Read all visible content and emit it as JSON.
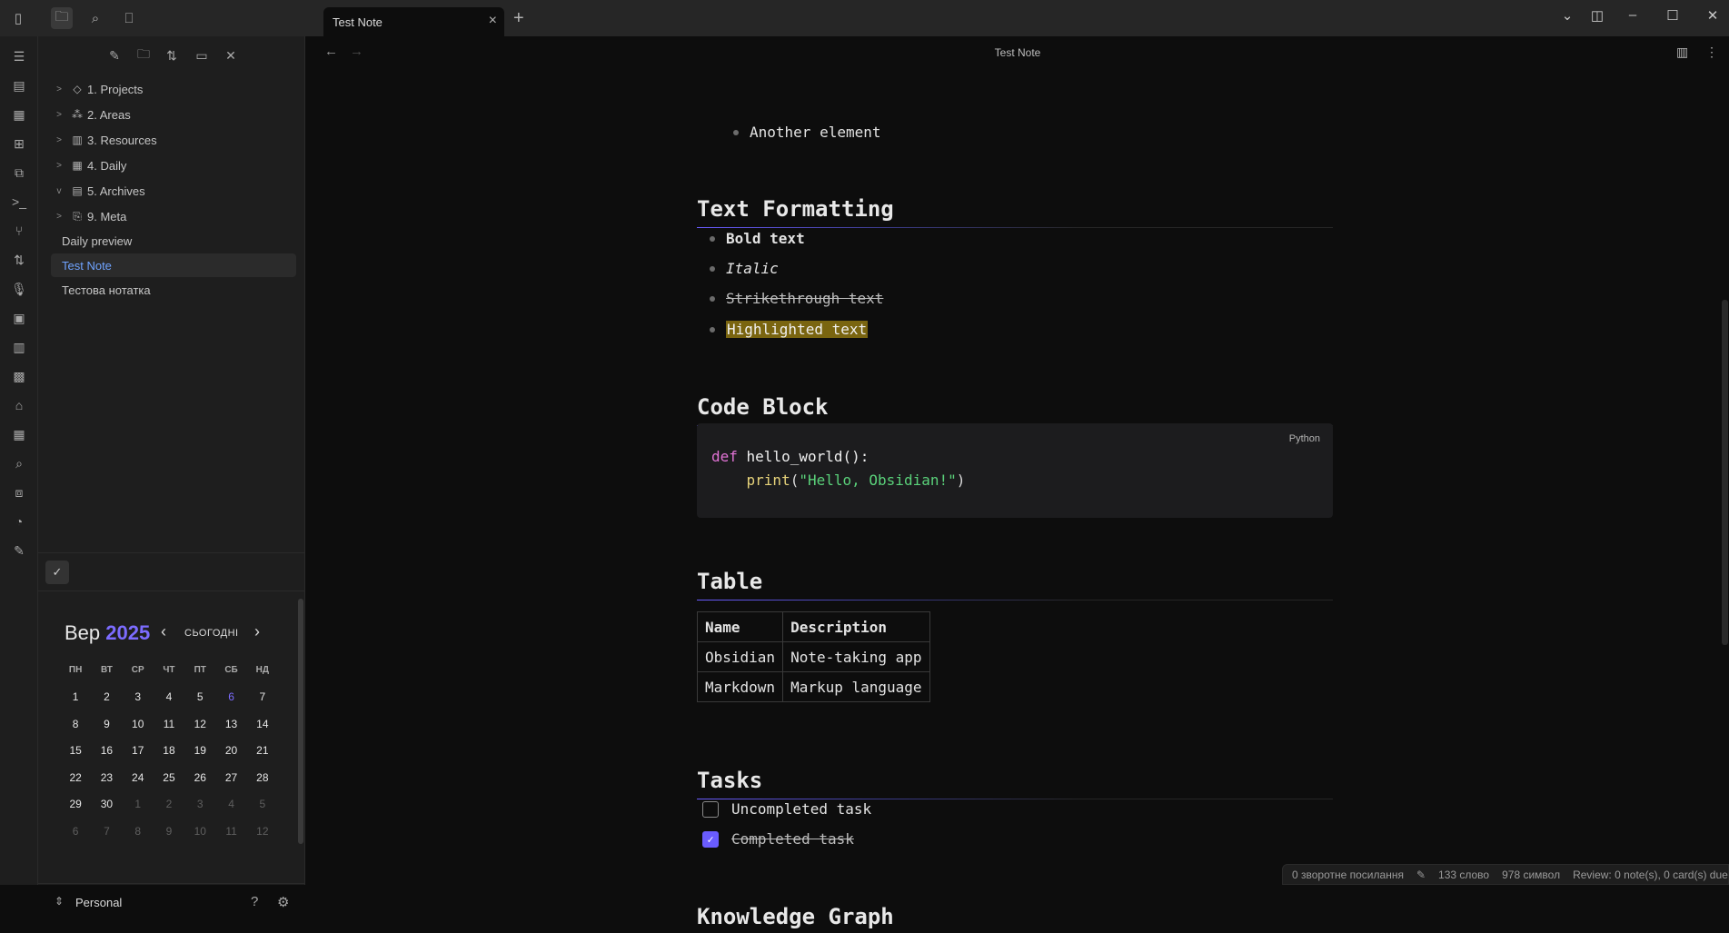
{
  "titlebar": {
    "tab_title": "Test Note",
    "tab_close_icon": "×",
    "new_tab_icon": "+"
  },
  "explorer": {
    "folders": [
      {
        "label": "1. Projects",
        "icon": "tag-icon",
        "expanded": false
      },
      {
        "label": "2. Areas",
        "icon": "areas-icon",
        "expanded": false
      },
      {
        "label": "3. Resources",
        "icon": "book-icon",
        "expanded": false
      },
      {
        "label": "4. Daily",
        "icon": "calendar-icon",
        "expanded": false
      },
      {
        "label": "5. Archives",
        "icon": "archive-icon",
        "expanded": true
      },
      {
        "label": "9. Meta",
        "icon": "meta-icon",
        "expanded": false
      }
    ],
    "files": [
      {
        "label": "Daily preview",
        "active": false
      },
      {
        "label": "Test Note",
        "active": true
      },
      {
        "label": "Тестова нотатка",
        "active": false
      }
    ]
  },
  "calendar": {
    "month": "Вер",
    "year": "2025",
    "today_label": "СЬОГОДНІ",
    "weekdays": [
      "ПН",
      "ВТ",
      "СР",
      "ЧТ",
      "ПТ",
      "СБ",
      "НД"
    ],
    "weeks": [
      [
        "1",
        "2",
        "3",
        "4",
        "5",
        "6",
        "7"
      ],
      [
        "8",
        "9",
        "10",
        "11",
        "12",
        "13",
        "14"
      ],
      [
        "15",
        "16",
        "17",
        "18",
        "19",
        "20",
        "21"
      ],
      [
        "22",
        "23",
        "24",
        "25",
        "26",
        "27",
        "28"
      ],
      [
        "29",
        "30",
        "1",
        "2",
        "3",
        "4",
        "5"
      ],
      [
        "6",
        "7",
        "8",
        "9",
        "10",
        "11",
        "12"
      ]
    ],
    "today_day": "6",
    "accent_color": "#7c6cff"
  },
  "vault": {
    "name": "Personal"
  },
  "note": {
    "nav_title": "Test Note",
    "list_item_top": "Another element",
    "sections": {
      "formatting": {
        "heading": "Text Formatting",
        "bold": "Bold text",
        "italic": "Italic",
        "strike": "Strikethrough text",
        "highlight": "Highlighted text"
      },
      "code": {
        "heading": "Code Block",
        "language": "Python",
        "line1_kw": "def",
        "line1_rest": " hello_world():",
        "line2_indent": "    ",
        "line2_fn": "print",
        "line2_open": "(",
        "line2_str": "\"Hello, Obsidian!\"",
        "line2_close": ")"
      },
      "table": {
        "heading": "Table",
        "headers": [
          "Name",
          "Description"
        ],
        "rows": [
          [
            "Obsidian",
            "Note-taking app"
          ],
          [
            "Markdown",
            "Markup language"
          ]
        ]
      },
      "tasks": {
        "heading": "Tasks",
        "items": [
          {
            "label": "Uncompleted task",
            "done": false
          },
          {
            "label": "Completed task",
            "done": true
          }
        ]
      },
      "graph": {
        "heading": "Knowledge Graph"
      }
    }
  },
  "status": {
    "backlinks": "0 зворотне посилання",
    "words": "133 слово",
    "chars": "978 символ",
    "review": "Review: 0 note(s), 0 card(s) due"
  },
  "colors": {
    "accent": "#6a5cff",
    "highlight": "#7a6510",
    "active_file": "#6fa3ff"
  }
}
